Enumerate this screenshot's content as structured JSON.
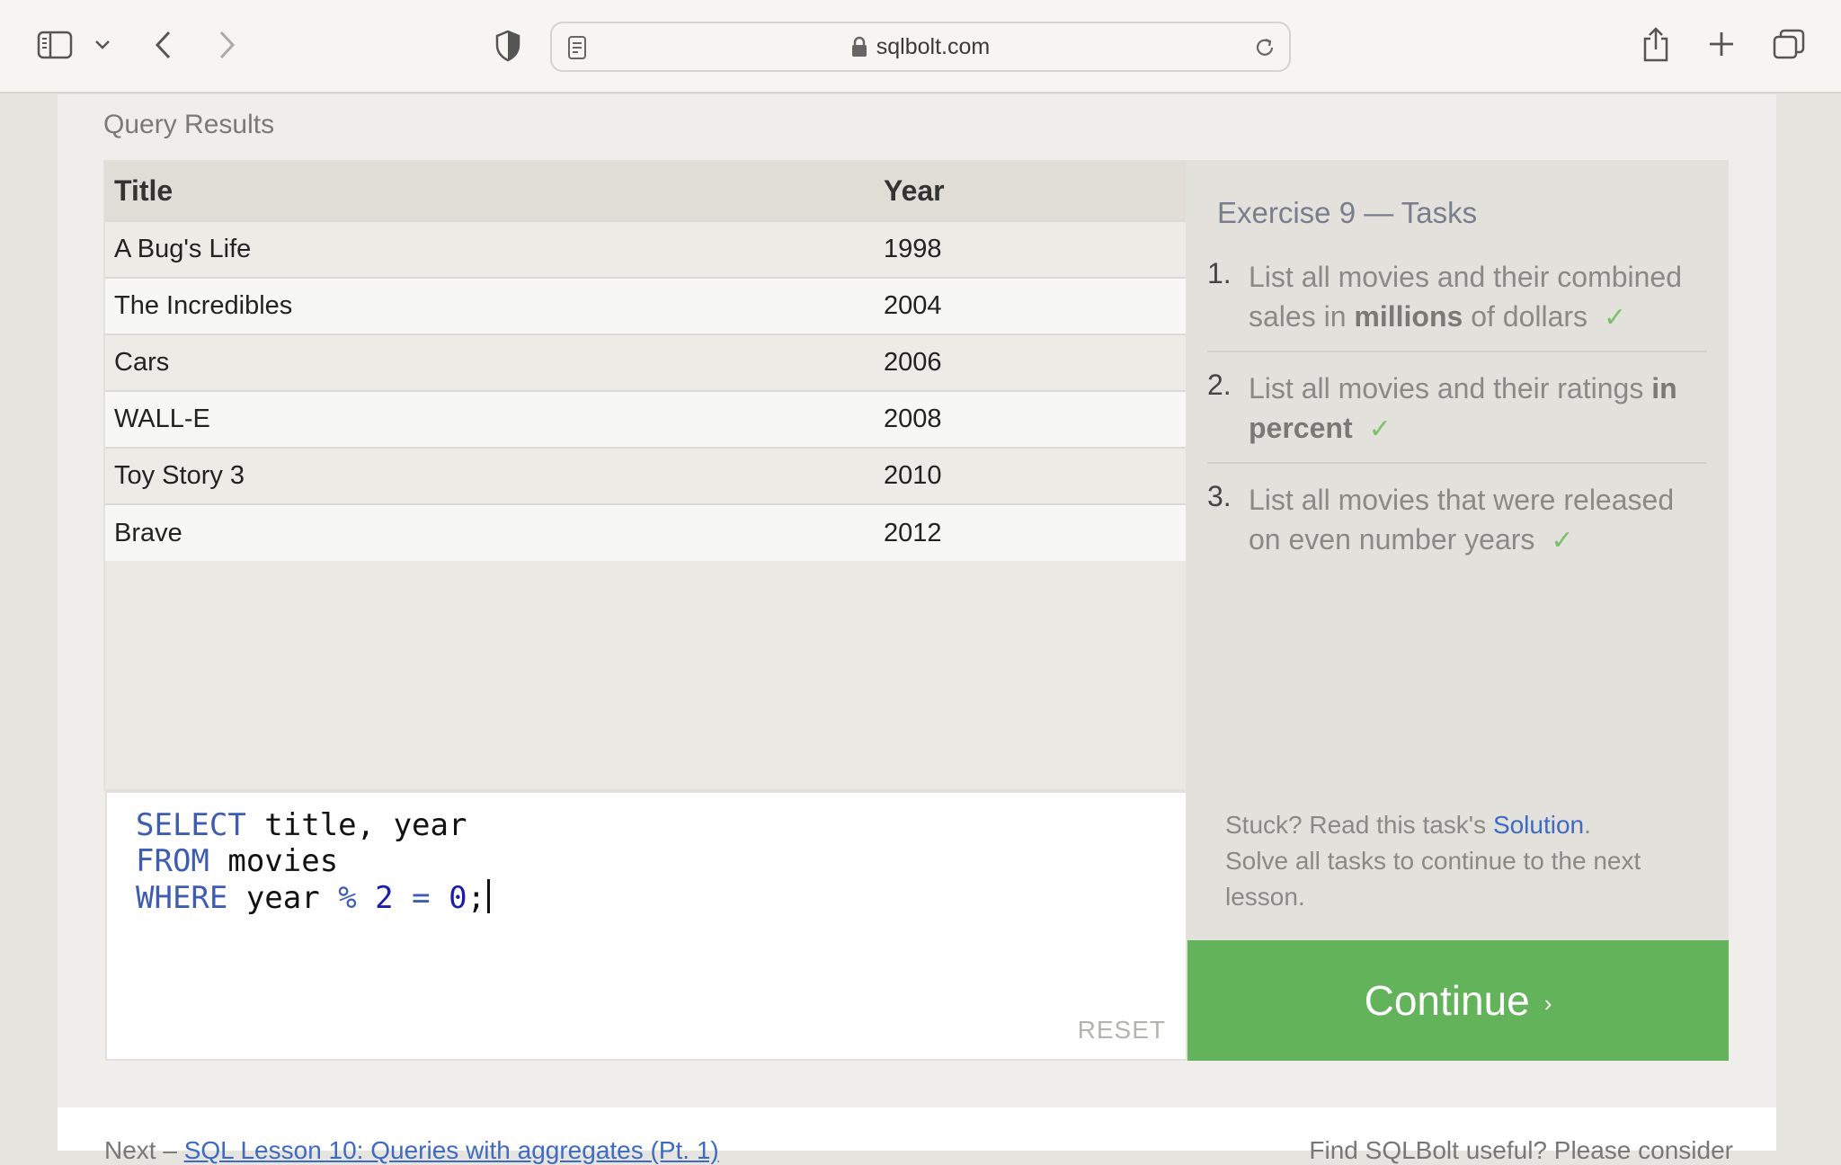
{
  "browser": {
    "url": "sqlbolt.com",
    "icons": [
      "sidebar-icon",
      "chevron-down-icon",
      "back-icon",
      "forward-icon",
      "shield-icon",
      "reader-icon",
      "lock-icon",
      "reload-icon",
      "share-icon",
      "new-tab-icon",
      "tabs-overview-icon"
    ]
  },
  "results": {
    "label": "Query Results",
    "columns": [
      "Title",
      "Year"
    ],
    "rows": [
      [
        "A Bug's Life",
        "1998"
      ],
      [
        "The Incredibles",
        "2004"
      ],
      [
        "Cars",
        "2006"
      ],
      [
        "WALL-E",
        "2008"
      ],
      [
        "Toy Story 3",
        "2010"
      ],
      [
        "Brave",
        "2012"
      ]
    ]
  },
  "editor": {
    "line1_kw": "SELECT",
    "line1_rest": " title, year",
    "line2_kw": "FROM",
    "line2_rest": " movies",
    "line3_kw": "WHERE",
    "line3_a": " year ",
    "line3_op1": "%",
    "line3_b": " ",
    "line3_num1": "2",
    "line3_c": " ",
    "line3_op2": "=",
    "line3_d": " ",
    "line3_num2": "0",
    "line3_end": ";",
    "reset_label": "RESET"
  },
  "tasks": {
    "title": "Exercise 9 — Tasks",
    "items": [
      {
        "num": "1.",
        "pre": "List all movies and their combined sales in ",
        "bold": "millions",
        "post": " of dollars",
        "check": "✓"
      },
      {
        "num": "2.",
        "pre": "List all movies and their ratings ",
        "bold": "in percent",
        "post": "",
        "check": "✓"
      },
      {
        "num": "3.",
        "pre": "List all movies that were released on even number years",
        "bold": "",
        "post": "",
        "check": "✓"
      }
    ],
    "stuck_pre": "Stuck? Read this task's ",
    "solution_link": "Solution",
    "stuck_post": ".",
    "solve_all": "Solve all tasks to continue to the next lesson."
  },
  "continue": {
    "label": "Continue",
    "chevron": "›"
  },
  "footer": {
    "next_label": "Next – ",
    "next_link": "SQL Lesson 10: Queries with aggregates (Pt. 1)",
    "right_text": "Find SQLBolt useful? Please consider"
  },
  "colors": {
    "accent_green": "#62b35a",
    "link_blue": "#3e6ac3",
    "keyword_blue": "#3e5db0"
  }
}
